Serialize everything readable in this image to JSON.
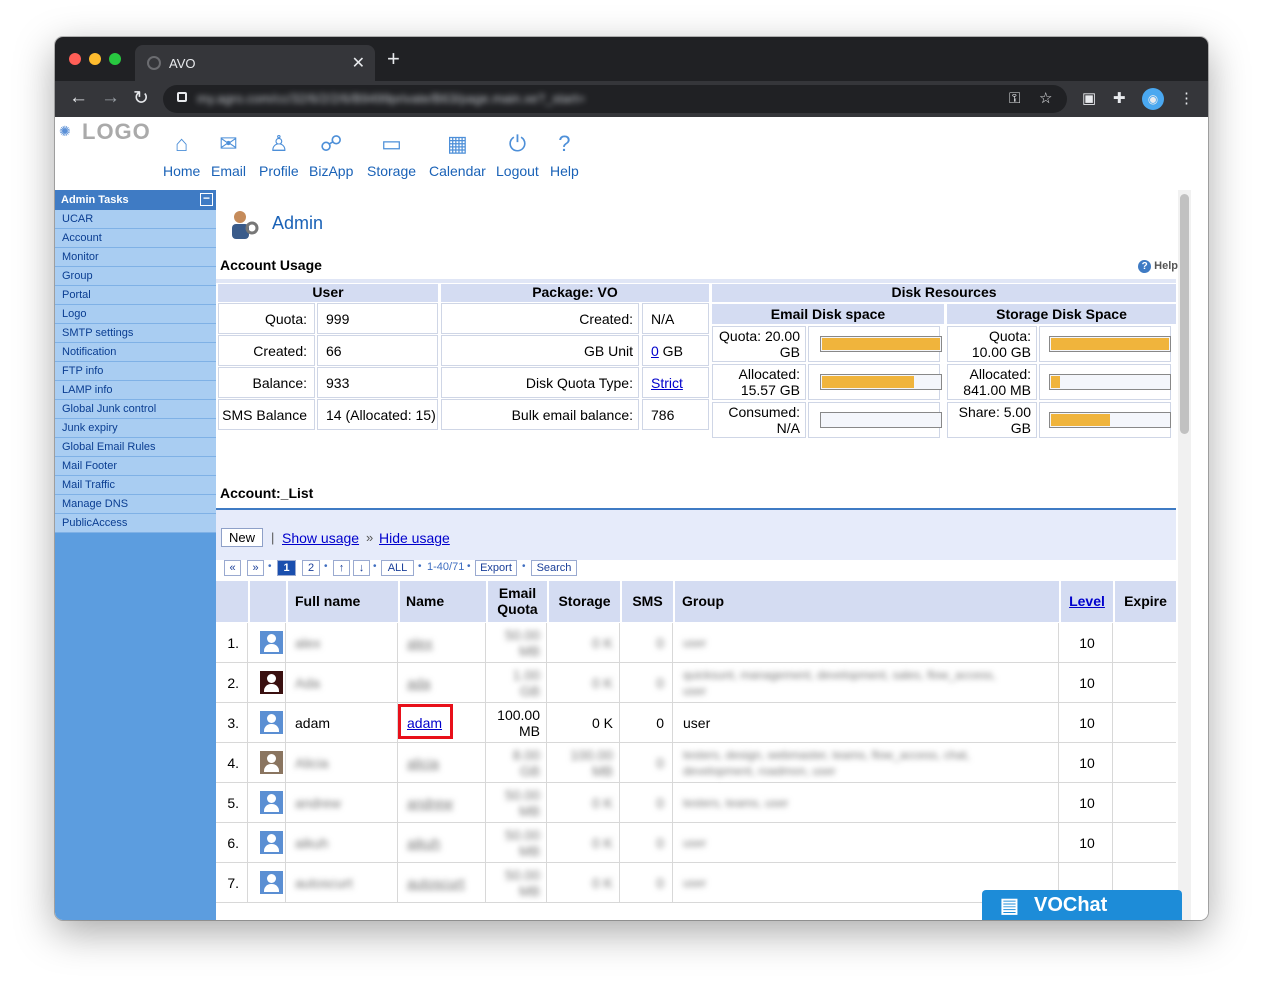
{
  "browser": {
    "tab_title": "AVO",
    "url": "my.agro.com/cc/32/6/2/2/6/B9499private/B63/page.main.xe?_start=",
    "colors": {
      "close": "#ff5f57",
      "min": "#febc2e",
      "max": "#28c840"
    }
  },
  "logo": {
    "text": "LOGO"
  },
  "topnav": [
    {
      "label": "Home",
      "icon": "home-icon",
      "glyph": "⌂"
    },
    {
      "label": "Email",
      "icon": "envelope-icon",
      "glyph": "✉"
    },
    {
      "label": "Profile",
      "icon": "person-icon",
      "glyph": "♙"
    },
    {
      "label": "BizApp",
      "icon": "handshake-icon",
      "glyph": "☍"
    },
    {
      "label": "Storage",
      "icon": "folder-icon",
      "glyph": "▭"
    },
    {
      "label": "Calendar",
      "icon": "calendar-icon",
      "glyph": "▦"
    },
    {
      "label": "Logout",
      "icon": "power-icon",
      "glyph": "⏻"
    },
    {
      "label": "Help",
      "icon": "question-icon",
      "glyph": "?"
    }
  ],
  "sidebar": {
    "title": "Admin Tasks",
    "items": [
      "UCAR",
      "Account",
      "Monitor",
      "Group",
      "Portal",
      "Logo",
      "SMTP settings",
      "Notification",
      "FTP info",
      "LAMP info",
      "Global Junk control",
      "Junk expiry",
      "Global Email Rules",
      "Mail Footer",
      "Mail Traffic",
      "Manage DNS",
      "PublicAccess"
    ]
  },
  "main": {
    "title": "Admin",
    "account_usage": "Account Usage",
    "help": "Help",
    "user_header": "User",
    "package_header": "Package: VO",
    "disk_header": "Disk Resources",
    "email_disk": "Email Disk space",
    "storage_disk": "Storage Disk Space",
    "user_rows": [
      {
        "label": "Quota:",
        "value": "999"
      },
      {
        "label": "Created:",
        "value": "66"
      },
      {
        "label": "Balance:",
        "value": "933"
      },
      {
        "label": "SMS Balance",
        "value": "14 (Allocated: 15)"
      }
    ],
    "package_rows": [
      {
        "label": "Created:",
        "value": "N/A"
      },
      {
        "label": "GB Unit",
        "link": "0",
        "suffix": " GB"
      },
      {
        "label": "Disk Quota Type:",
        "link": "Strict",
        "suffix": ""
      },
      {
        "label": "Bulk email balance:",
        "value": "786"
      }
    ],
    "email_rows": [
      {
        "l1": "Quota: 20.00",
        "l2": "GB",
        "fill": 1.0
      },
      {
        "l1": "Allocated:",
        "l2": "15.57 GB",
        "fill": 0.78
      },
      {
        "l1": "Consumed:",
        "l2": "N/A",
        "fill": 0
      }
    ],
    "storage_rows": [
      {
        "l1": "Quota:",
        "l2": "10.00 GB",
        "fill": 1.0
      },
      {
        "l1": "Allocated:",
        "l2": "841.00 MB",
        "fill": 0.08
      },
      {
        "l1": "Share: 5.00",
        "l2": "GB",
        "fill": 0.5
      }
    ],
    "list_title": "Account:_List",
    "new_btn": "New",
    "sep": "|",
    "show_usage": "Show usage",
    "arrows": "»",
    "hide_usage": "Hide usage",
    "pager": {
      "first": "«",
      "next": "»",
      "p1": "1",
      "p2": "2",
      "up": "↑",
      "down": "↓",
      "all": "ALL",
      "range": "1-40/71",
      "export": "Export",
      "search": "Search",
      "dot": "•"
    },
    "columns": {
      "fullname": "Full name",
      "name": "Name",
      "quota1": "Email",
      "quota2": "Quota",
      "storage": "Storage",
      "sms": "SMS",
      "group": "Group",
      "level": "Level",
      "expire": "Expire"
    },
    "rows": [
      {
        "n": "1.",
        "full": "alex",
        "name": "alex",
        "q1": "50.00",
        "q2": "MB",
        "st": "0 K",
        "sms": "0",
        "g1": "user",
        "g2": "",
        "lvl": "10",
        "blur": true
      },
      {
        "n": "2.",
        "full": "Ada",
        "name": "ada",
        "q1": "1.00",
        "q2": "GB",
        "st": "0 K",
        "sms": "0",
        "g1": "quicksunt, management, development, sales, flow_access,",
        "g2": "user",
        "lvl": "10",
        "blur": true
      },
      {
        "n": "3.",
        "full": "adam",
        "name": "adam",
        "q1": "100.00",
        "q2": "MB",
        "st": "0 K",
        "sms": "0",
        "g1": "user",
        "g2": "",
        "lvl": "10",
        "blur": false
      },
      {
        "n": "4.",
        "full": "Alicia",
        "name": "alicia",
        "q1": "8.00",
        "q2": "GB",
        "st": "100.00",
        "st2": "MB",
        "sms": "0",
        "g1": "testers, design, webmaster, teams, flow_access, chat,",
        "g2": "development, roadmon, user",
        "lvl": "10",
        "blur": true
      },
      {
        "n": "5.",
        "full": "andrew",
        "name": "andrew",
        "q1": "50.00",
        "q2": "MB",
        "st": "0 K",
        "sms": "0",
        "g1": "testers, teams, user",
        "g2": "",
        "lvl": "10",
        "blur": true
      },
      {
        "n": "6.",
        "full": "aikuh",
        "name": "aikuh",
        "q1": "50.00",
        "q2": "MB",
        "st": "0 K",
        "sms": "0",
        "g1": "user",
        "g2": "",
        "lvl": "10",
        "blur": true
      },
      {
        "n": "7.",
        "full": "autoscurt",
        "name": "autoscurt",
        "q1": "50.00",
        "q2": "MB",
        "st": "0 K",
        "sms": "0",
        "g1": "user",
        "g2": "",
        "lvl": "",
        "blur": true
      }
    ]
  },
  "chat": {
    "label": "VOChat"
  }
}
